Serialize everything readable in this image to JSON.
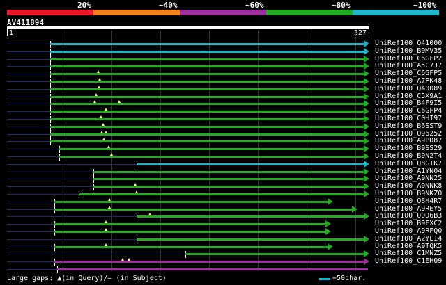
{
  "legend": {
    "labels": [
      "20%",
      "~40%",
      "~60%",
      "~80%",
      "~100%"
    ],
    "colors": [
      "#e8192c",
      "#f07f1a",
      "#9b2f9b",
      "#22aa22",
      "#1fb4c8"
    ]
  },
  "query": {
    "id": "AV411894",
    "start": "1",
    "end": "327",
    "length": 327
  },
  "footer": {
    "gaps_text": "Large gaps: ▲(in Query)/– (in Subject)",
    "scale_text": "=50char."
  },
  "hits": [
    {
      "name": "UniRef100_Q41000",
      "s": 1,
      "e": 327,
      "color": "#1fb4c8",
      "arrow": true,
      "tick": 1,
      "gaps": []
    },
    {
      "name": "UniRef100_B9MV35",
      "s": 1,
      "e": 327,
      "color": "#1fb4c8",
      "arrow": true,
      "tick": 1,
      "gaps": []
    },
    {
      "name": "UniRef100_C6GFP2",
      "s": 1,
      "e": 327,
      "color": "#22aa22",
      "arrow": true,
      "tick": 1,
      "gaps": []
    },
    {
      "name": "UniRef100_A5C7J7",
      "s": 1,
      "e": 327,
      "color": "#22aa22",
      "arrow": true,
      "tick": 1,
      "gaps": []
    },
    {
      "name": "UniRef100_C6GFP5",
      "s": 1,
      "e": 327,
      "color": "#22aa22",
      "arrow": true,
      "tick": 1,
      "gaps": [
        50
      ]
    },
    {
      "name": "UniRef100_A7PK48",
      "s": 1,
      "e": 327,
      "color": "#22aa22",
      "arrow": true,
      "tick": 1,
      "gaps": [
        52
      ]
    },
    {
      "name": "UniRef100_Q40089",
      "s": 1,
      "e": 327,
      "color": "#22aa22",
      "arrow": true,
      "tick": 1,
      "gaps": [
        51
      ]
    },
    {
      "name": "UniRef100_C5X9A1",
      "s": 1,
      "e": 327,
      "color": "#22aa22",
      "arrow": true,
      "tick": 1,
      "gaps": [
        48
      ]
    },
    {
      "name": "UniRef100_B4F9I5",
      "s": 1,
      "e": 327,
      "color": "#22aa22",
      "arrow": true,
      "tick": 1,
      "gaps": [
        47,
        72
      ]
    },
    {
      "name": "UniRef100_C6GFP4",
      "s": 1,
      "e": 327,
      "color": "#22aa22",
      "arrow": true,
      "tick": 1,
      "gaps": [
        58
      ]
    },
    {
      "name": "UniRef100_C0HI97",
      "s": 1,
      "e": 327,
      "color": "#22aa22",
      "arrow": true,
      "tick": 1,
      "gaps": [
        53
      ]
    },
    {
      "name": "UniRef100_B6SST9",
      "s": 1,
      "e": 327,
      "color": "#22aa22",
      "arrow": true,
      "tick": 1,
      "gaps": [
        55
      ]
    },
    {
      "name": "UniRef100_Q96252",
      "s": 1,
      "e": 327,
      "color": "#22aa22",
      "arrow": true,
      "tick": 1,
      "gaps": [
        54,
        58
      ]
    },
    {
      "name": "UniRef100_A9PD87",
      "s": 1,
      "e": 327,
      "color": "#22aa22",
      "arrow": true,
      "tick": 1,
      "gaps": [
        56
      ]
    },
    {
      "name": "UniRef100_B9SS29",
      "s": 10,
      "e": 327,
      "color": "#22aa22",
      "arrow": true,
      "tick": 10,
      "gaps": [
        61
      ]
    },
    {
      "name": "UniRef100_B9N2T4",
      "s": 10,
      "e": 327,
      "color": "#22aa22",
      "arrow": true,
      "tick": 10,
      "gaps": [
        64
      ]
    },
    {
      "name": "UniRef100_Q8GTK7",
      "s": 90,
      "e": 327,
      "color": "#1fb4c8",
      "arrow": true,
      "tick": 90,
      "gaps": []
    },
    {
      "name": "UniRef100_A1YN04",
      "s": 45,
      "e": 327,
      "color": "#22aa22",
      "arrow": true,
      "tick": 45,
      "gaps": []
    },
    {
      "name": "UniRef100_A9NN25",
      "s": 45,
      "e": 327,
      "color": "#22aa22",
      "arrow": true,
      "tick": 45,
      "gaps": []
    },
    {
      "name": "UniRef100_A9NNK8",
      "s": 45,
      "e": 327,
      "color": "#22aa22",
      "arrow": true,
      "tick": 45,
      "gaps": [
        88
      ]
    },
    {
      "name": "UniRef100_B9NKZ0",
      "s": 30,
      "e": 327,
      "color": "#22aa22",
      "arrow": true,
      "tick": 30,
      "gaps": [
        90
      ]
    },
    {
      "name": "UniRef100_Q8H4R7",
      "s": 5,
      "e": 290,
      "color": "#22aa22",
      "arrow": true,
      "tick": 5,
      "gaps": [
        62
      ]
    },
    {
      "name": "UniRef100_A9REY5",
      "s": 5,
      "e": 315,
      "color": "#22aa22",
      "arrow": true,
      "tick": 5,
      "gaps": [
        62
      ]
    },
    {
      "name": "UniRef100_Q0D6B3",
      "s": 90,
      "e": 327,
      "color": "#22aa22",
      "arrow": true,
      "tick": 90,
      "gaps": [
        103
      ]
    },
    {
      "name": "UniRef100_B9FXC2",
      "s": 5,
      "e": 288,
      "color": "#22aa22",
      "arrow": true,
      "tick": 5,
      "gaps": [
        58
      ]
    },
    {
      "name": "UniRef100_A9RFQ0",
      "s": 5,
      "e": 288,
      "color": "#22aa22",
      "arrow": true,
      "tick": 5,
      "gaps": [
        58
      ]
    },
    {
      "name": "UniRef100_A2YLI4",
      "s": 90,
      "e": 327,
      "color": "#22aa22",
      "arrow": true,
      "tick": 90,
      "gaps": []
    },
    {
      "name": "UniRef100_A9TQK5",
      "s": 5,
      "e": 290,
      "color": "#22aa22",
      "arrow": true,
      "tick": 5,
      "gaps": [
        58
      ]
    },
    {
      "name": "UniRef100_C1MNZ5",
      "s": 140,
      "e": 327,
      "color": "#22aa22",
      "arrow": true,
      "tick": 140,
      "gaps": []
    },
    {
      "name": "UniRef100_C1EH09",
      "s": 5,
      "e": 327,
      "color": "#9b2f9b",
      "arrow": true,
      "tick": 5,
      "gaps": [
        75,
        82
      ]
    },
    {
      "name": "",
      "s": 8,
      "e": 327,
      "color": "#9b2f9b",
      "arrow": false,
      "tick": 8,
      "gaps": []
    }
  ]
}
